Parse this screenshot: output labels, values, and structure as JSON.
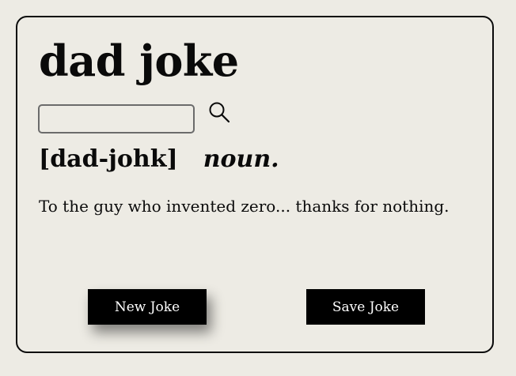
{
  "card": {
    "title": "dad joke",
    "search": {
      "value": "",
      "placeholder": "",
      "icon": "search-icon"
    },
    "pronunciation": "[dad-johk]",
    "part_of_speech": "noun.",
    "definition": "To the guy who invented zero... thanks for nothing."
  },
  "actions": {
    "new_joke_label": "New Joke",
    "save_joke_label": "Save Joke"
  },
  "colors": {
    "background": "#edebe4",
    "text": "#0a0a0a",
    "button_bg": "#000000",
    "button_text": "#ffffff"
  }
}
